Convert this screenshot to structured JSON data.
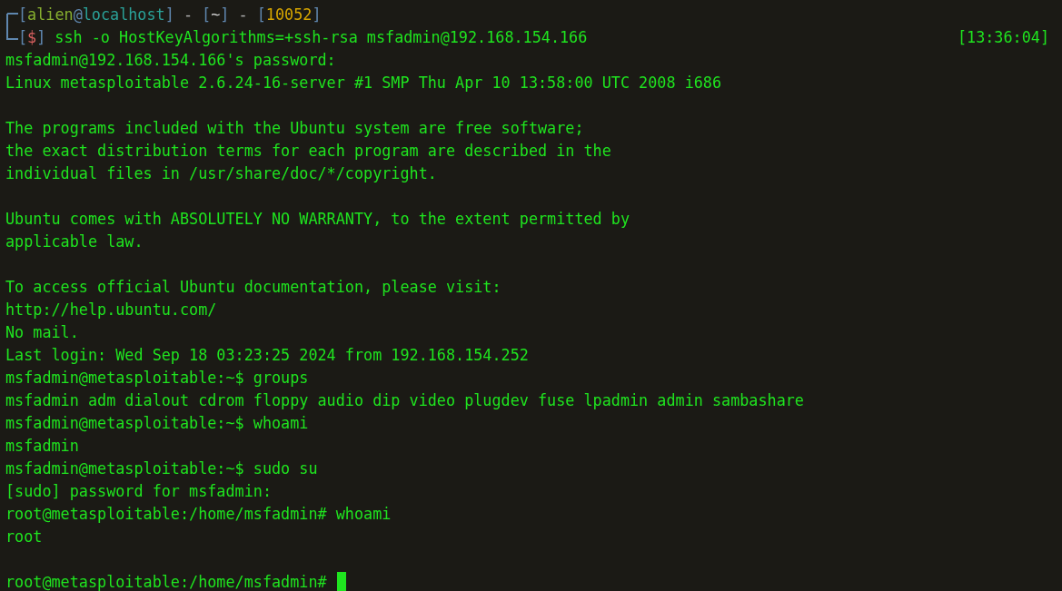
{
  "prompt": {
    "segments": [
      {
        "text": "[",
        "color": "#5f87af"
      },
      {
        "text": "alien",
        "color": "#87af2f"
      },
      {
        "text": "@",
        "color": "#5f87af"
      },
      {
        "text": "localhost",
        "color": "#2aa198"
      },
      {
        "text": "]",
        "color": "#5f87af"
      },
      {
        "text": " - ",
        "color": "#b0b0b0"
      },
      {
        "text": "[",
        "color": "#5f87af"
      },
      {
        "text": "~",
        "color": "#d0d0d0"
      },
      {
        "text": "]",
        "color": "#5f87af"
      },
      {
        "text": " - ",
        "color": "#b0b0b0"
      },
      {
        "text": "[",
        "color": "#5f87af"
      },
      {
        "text": "10052",
        "color": "#d7a600"
      },
      {
        "text": "]",
        "color": "#5f87af"
      }
    ],
    "symbol_segments": [
      {
        "text": "[",
        "color": "#5f87af"
      },
      {
        "text": "$",
        "color": "#d75f5f"
      },
      {
        "text": "]",
        "color": "#5f87af"
      }
    ],
    "command": "ssh -o HostKeyAlgorithms=+ssh-rsa msfadmin@192.168.154.166",
    "time": "[13:36:04]"
  },
  "output": [
    [
      "msfadmin@192.168.154.166's password:",
      "Linux metasploitable 2.6.24-16-server #1 SMP Thu Apr 10 13:58:00 UTC 2008 i686"
    ],
    [
      "The programs included with the Ubuntu system are free software;",
      "the exact distribution terms for each program are described in the",
      "individual files in /usr/share/doc/*/copyright."
    ],
    [
      "Ubuntu comes with ABSOLUTELY NO WARRANTY, to the extent permitted by",
      "applicable law."
    ],
    [
      "To access official Ubuntu documentation, please visit:",
      "http://help.ubuntu.com/",
      "No mail.",
      "Last login: Wed Sep 18 03:23:25 2024 from 192.168.154.252",
      "msfadmin@metasploitable:~$ groups",
      "msfadmin adm dialout cdrom floppy audio dip video plugdev fuse lpadmin admin sambashare",
      "msfadmin@metasploitable:~$ whoami",
      "msfadmin",
      "msfadmin@metasploitable:~$ sudo su",
      "[sudo] password for msfadmin:",
      "root@metasploitable:/home/msfadmin# whoami",
      "root"
    ]
  ],
  "current_prompt": "root@metasploitable:/home/msfadmin# "
}
